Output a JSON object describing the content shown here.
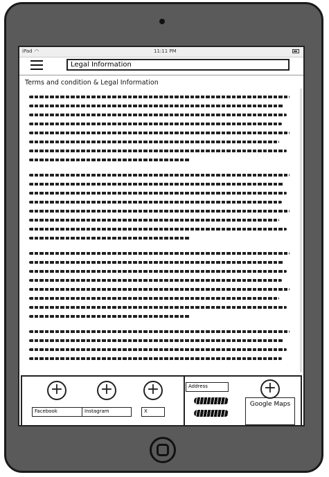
{
  "status_bar": {
    "carrier": "iPad",
    "time": "11:11 PM"
  },
  "header": {
    "title": "Legal Information"
  },
  "content": {
    "heading": "Terms and condition & Legal Information",
    "paragraphs": [
      {
        "lines": 8
      },
      {
        "lines": 8
      },
      {
        "lines": 8
      },
      {
        "lines": 4
      }
    ]
  },
  "footer": {
    "social": [
      {
        "label": "Facebook",
        "icon": "plus-circle-icon"
      },
      {
        "label": "Instagram",
        "icon": "plus-circle-icon"
      },
      {
        "label": "X",
        "icon": "plus-circle-icon"
      }
    ],
    "address_label": "Address",
    "maps": {
      "label": "Google Maps",
      "icon": "plus-circle-icon"
    }
  }
}
